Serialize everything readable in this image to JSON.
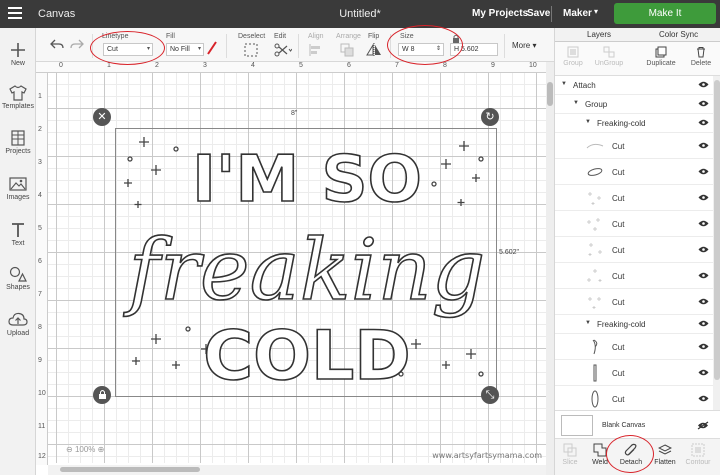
{
  "app": {
    "title": "Canvas",
    "document_title": "Untitled*",
    "my_projects": "My Projects",
    "save": "Save",
    "machine": "Maker",
    "make_it": "Make It"
  },
  "sidebar": {
    "items": [
      {
        "label": "New",
        "icon": "plus-icon"
      },
      {
        "label": "Templates",
        "icon": "shirt-icon"
      },
      {
        "label": "Projects",
        "icon": "grid-icon"
      },
      {
        "label": "Images",
        "icon": "image-icon"
      },
      {
        "label": "Text",
        "icon": "text-icon"
      },
      {
        "label": "Shapes",
        "icon": "shapes-icon"
      },
      {
        "label": "Upload",
        "icon": "cloud-upload-icon"
      }
    ]
  },
  "toolbar": {
    "linetype_label": "Linetype",
    "linetype_value": "Cut",
    "fill_label": "Fill",
    "fill_value": "No Fill",
    "deselect_label": "Deselect",
    "edit_label": "Edit",
    "align_label": "Align",
    "arrange_label": "Arrange",
    "flip_label": "Flip",
    "size_label": "Size",
    "width_prefix": "W",
    "width_value": "8",
    "height_prefix": "H",
    "height_value": "5.602",
    "more_label": "More"
  },
  "ruler": {
    "h_ticks": [
      "0",
      "1",
      "2",
      "3",
      "4",
      "5",
      "6",
      "7",
      "8",
      "9",
      "10"
    ],
    "v_ticks": [
      "1",
      "2",
      "3",
      "4",
      "5",
      "6",
      "7",
      "8",
      "9",
      "10",
      "11",
      "12"
    ]
  },
  "canvas": {
    "width_label": "8\"",
    "height_label": "5.602\"",
    "zoom": "100%",
    "watermark": "www.artsyfartsymama.com",
    "design_lines": [
      "I'M SO",
      "freaking",
      "COLD"
    ]
  },
  "layers_panel": {
    "tabs": [
      "Layers",
      "Color Sync"
    ],
    "tools": [
      {
        "label": "Group",
        "enabled": false
      },
      {
        "label": "UnGroup",
        "enabled": false
      },
      {
        "label": "Duplicate",
        "enabled": true
      },
      {
        "label": "Delete",
        "enabled": true
      }
    ],
    "rows": [
      {
        "type": "group",
        "name": "Attach"
      },
      {
        "type": "group",
        "name": "Group"
      },
      {
        "type": "group",
        "name": "Freaking-cold"
      },
      {
        "type": "item",
        "name": "Cut"
      },
      {
        "type": "item",
        "name": "Cut"
      },
      {
        "type": "item",
        "name": "Cut"
      },
      {
        "type": "item",
        "name": "Cut"
      },
      {
        "type": "item",
        "name": "Cut"
      },
      {
        "type": "item",
        "name": "Cut"
      },
      {
        "type": "item",
        "name": "Cut"
      },
      {
        "type": "group",
        "name": "Freaking-cold"
      },
      {
        "type": "item",
        "name": "Cut"
      },
      {
        "type": "item",
        "name": "Cut"
      },
      {
        "type": "item",
        "name": "Cut"
      }
    ],
    "blank_canvas": "Blank Canvas",
    "bottom_tools": [
      {
        "label": "Slice",
        "enabled": false
      },
      {
        "label": "Weld",
        "enabled": true
      },
      {
        "label": "Detach",
        "enabled": true
      },
      {
        "label": "Flatten",
        "enabled": true
      },
      {
        "label": "Contour",
        "enabled": false
      }
    ]
  },
  "colors": {
    "topbar": "#3a3a3a",
    "make_it_green": "#3e9b3b",
    "annotation_red": "#d8232a"
  }
}
